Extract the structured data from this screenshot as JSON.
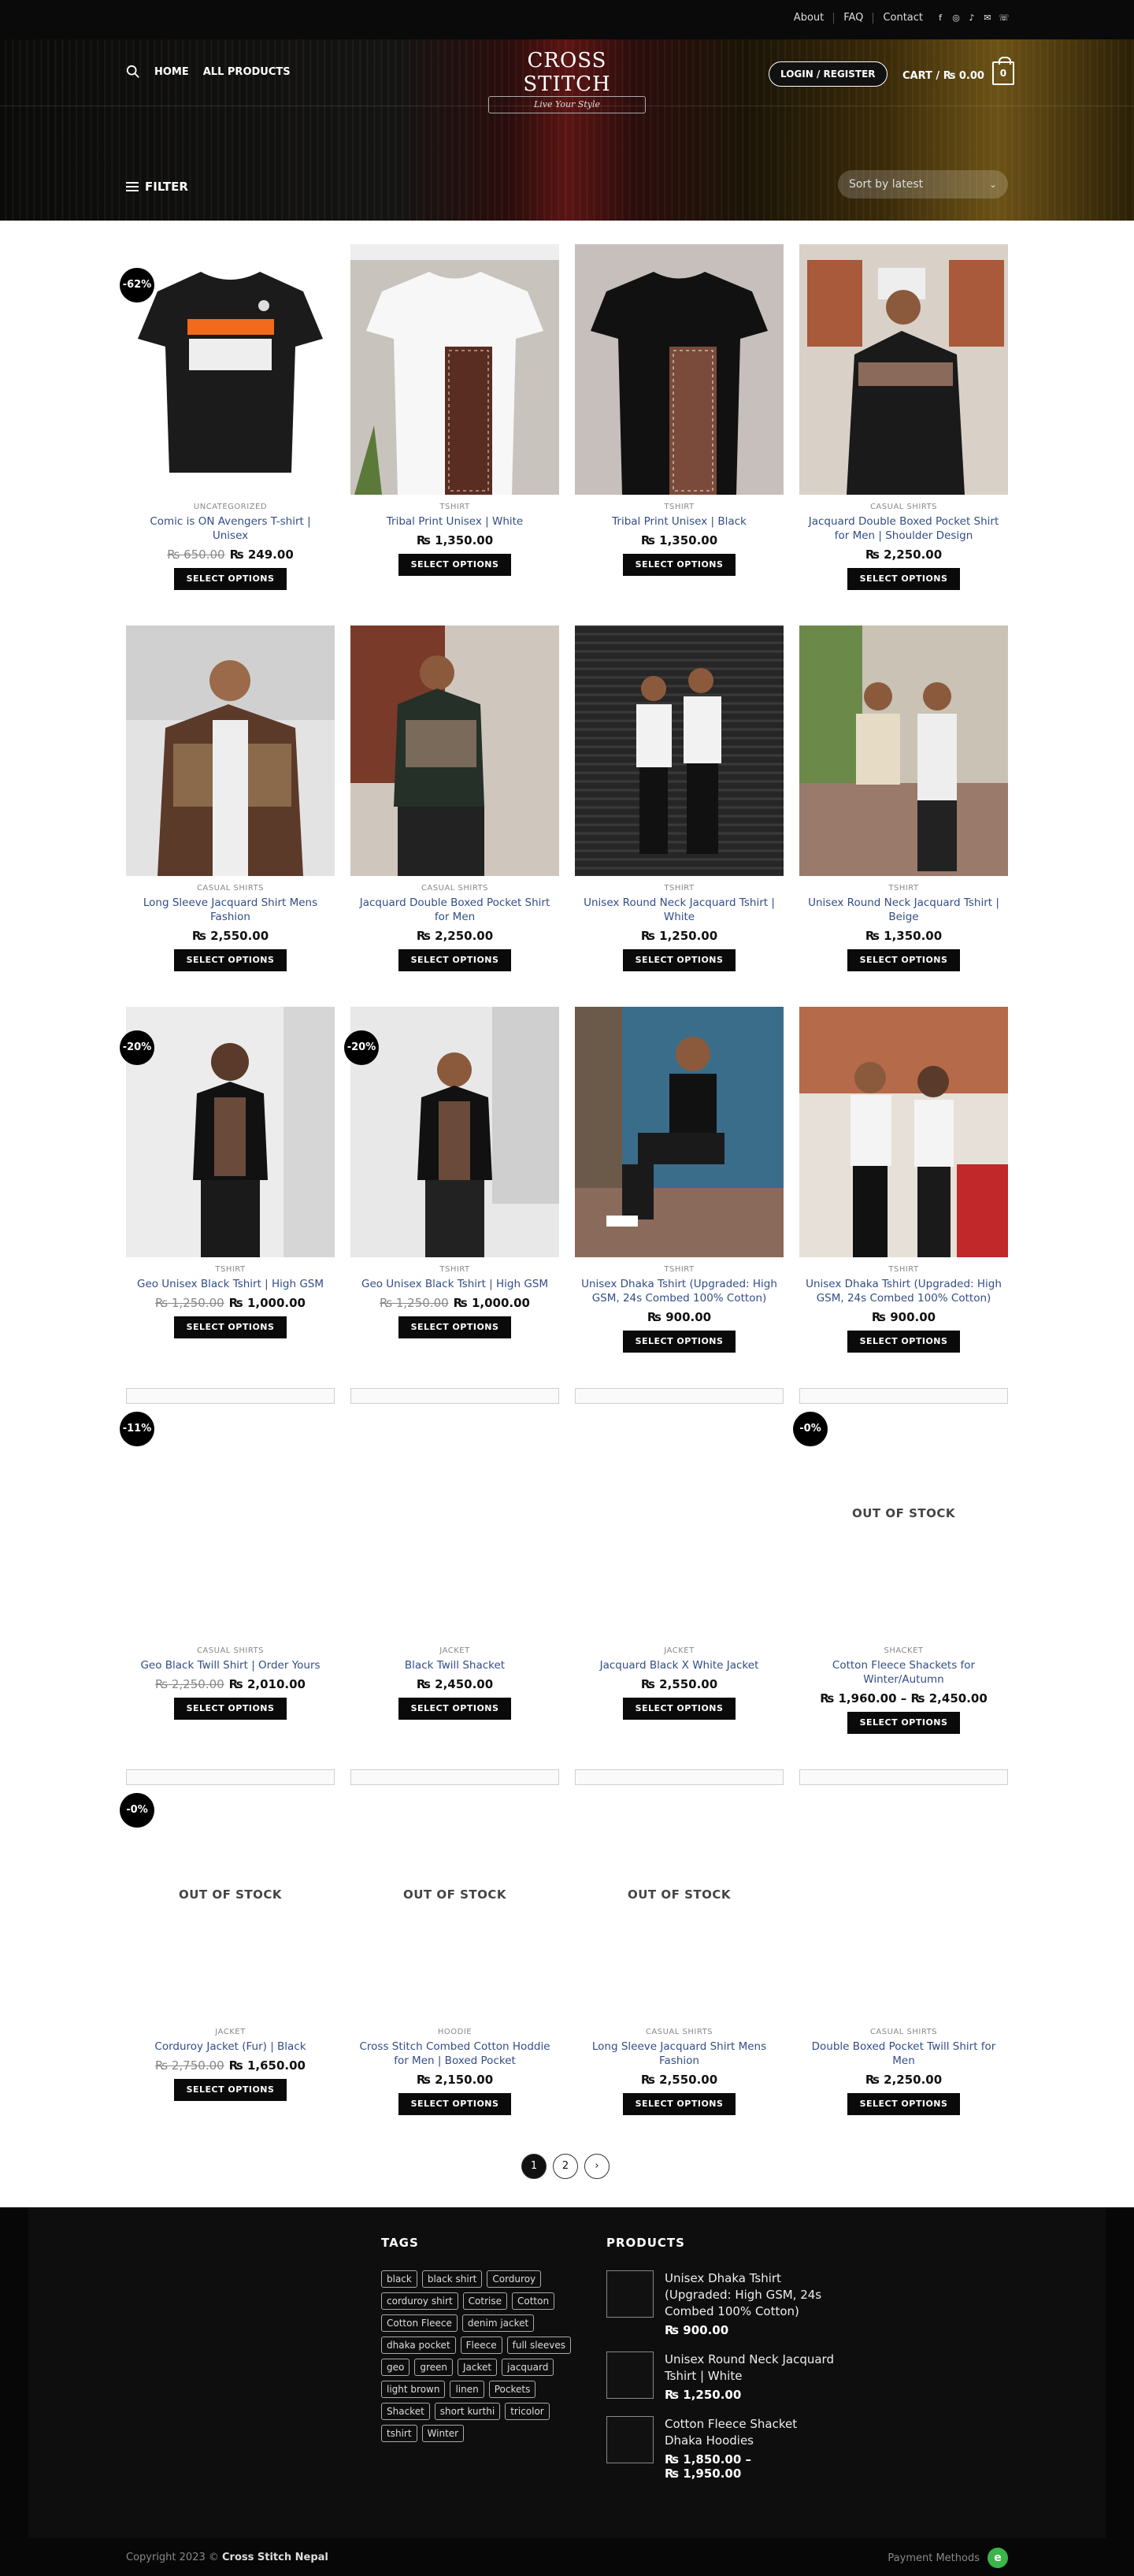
{
  "topbar": {
    "links": [
      "About",
      "FAQ",
      "Contact"
    ],
    "social_icons": [
      "facebook-icon",
      "instagram-icon",
      "tiktok-icon",
      "mail-icon",
      "phone-icon"
    ]
  },
  "header": {
    "nav": [
      "HOME",
      "ALL PRODUCTS"
    ],
    "logo_name": "CROSS STITCH",
    "logo_tagline": "Live Your Style",
    "login_label": "LOGIN / REGISTER",
    "cart_label": "CART / ₨ 0.00",
    "cart_count": "0",
    "filter_label": "FILTER",
    "sort_label": "Sort by latest"
  },
  "select_label": "SELECT OPTIONS",
  "products": [
    {
      "category": "UNCATEGORIZED",
      "title": "Comic is ON Avengers T-shirt | Unisex",
      "old_price": "₨ 650.00",
      "price": "₨ 249.00",
      "badge": "-62%",
      "image": "comic-tee",
      "oos": ""
    },
    {
      "category": "TSHIRT",
      "title": "Tribal Print Unisex | White",
      "old_price": "",
      "price": "₨ 1,350.00",
      "badge": "",
      "image": "white-tribal",
      "oos": ""
    },
    {
      "category": "TSHIRT",
      "title": "Tribal Print Unisex | Black",
      "old_price": "",
      "price": "₨ 1,350.00",
      "badge": "",
      "image": "black-tribal",
      "oos": ""
    },
    {
      "category": "CASUAL SHIRTS",
      "title": "Jacquard Double Boxed Pocket Shirt for Men | Shoulder Design",
      "old_price": "",
      "price": "₨ 2,250.00",
      "badge": "",
      "image": "street-shirt",
      "oos": ""
    },
    {
      "category": "CASUAL SHIRTS",
      "title": "Long Sleeve Jacquard Shirt Mens Fashion",
      "old_price": "",
      "price": "₨ 2,550.00",
      "badge": "",
      "image": "jacquard-longsleeve",
      "oos": ""
    },
    {
      "category": "CASUAL SHIRTS",
      "title": "Jacquard Double Boxed Pocket Shirt for Men",
      "old_price": "",
      "price": "₨ 2,250.00",
      "badge": "",
      "image": "temple-shirt",
      "oos": ""
    },
    {
      "category": "TSHIRT",
      "title": "Unisex Round Neck Jacquard Tshirt | White",
      "old_price": "",
      "price": "₨ 1,250.00",
      "badge": "",
      "image": "shutter-couple",
      "oos": ""
    },
    {
      "category": "TSHIRT",
      "title": "Unisex Round Neck Jacquard Tshirt | Beige",
      "old_price": "",
      "price": "₨ 1,350.00",
      "badge": "",
      "image": "beige-couple",
      "oos": ""
    },
    {
      "category": "TSHIRT",
      "title": "Geo Unisex Black Tshirt | High GSM",
      "old_price": "₨ 1,250.00",
      "price": "₨ 1,000.00",
      "badge": "-20%",
      "image": "geo-woman",
      "oos": ""
    },
    {
      "category": "TSHIRT",
      "title": "Geo Unisex Black Tshirt | High GSM",
      "old_price": "₨ 1,250.00",
      "price": "₨ 1,000.00",
      "badge": "-20%",
      "image": "geo-man",
      "oos": ""
    },
    {
      "category": "TSHIRT",
      "title": "Unisex Dhaka Tshirt (Upgraded: High GSM, 24s Combed 100% Cotton)",
      "old_price": "",
      "price": "₨ 900.00",
      "badge": "",
      "image": "dhaka-sitting",
      "oos": ""
    },
    {
      "category": "TSHIRT",
      "title": "Unisex Dhaka Tshirt (Upgraded: High GSM, 24s Combed 100% Cotton)",
      "old_price": "",
      "price": "₨ 900.00",
      "badge": "",
      "image": "dhaka-couple",
      "oos": ""
    },
    {
      "category": "CASUAL SHIRTS",
      "title": "Geo Black Twill Shirt | Order Yours",
      "old_price": "₨ 2,250.00",
      "price": "₨ 2,010.00",
      "badge": "-11%",
      "image": "broken",
      "oos": ""
    },
    {
      "category": "JACKET",
      "title": "Black Twill Shacket",
      "old_price": "",
      "price": "₨ 2,450.00",
      "badge": "",
      "image": "broken",
      "oos": ""
    },
    {
      "category": "JACKET",
      "title": "Jacquard Black X White Jacket",
      "old_price": "",
      "price": "₨ 2,550.00",
      "badge": "",
      "image": "broken",
      "oos": ""
    },
    {
      "category": "SHACKET",
      "title": "Cotton Fleece Shackets for Winter/Autumn",
      "old_price": "",
      "price": "₨ 1,960.00 – ₨ 2,450.00",
      "badge": "-0%",
      "image": "broken",
      "oos": "OUT OF STOCK"
    },
    {
      "category": "JACKET",
      "title": "Corduroy Jacket (Fur) | Black",
      "old_price": "₨ 2,750.00",
      "price": "₨ 1,650.00",
      "badge": "-0%",
      "image": "broken",
      "oos": "OUT OF STOCK"
    },
    {
      "category": "HOODIE",
      "title": "Cross Stitch Combed Cotton Hoddie for Men | Boxed Pocket",
      "old_price": "",
      "price": "₨ 2,150.00",
      "badge": "",
      "image": "broken",
      "oos": "OUT OF STOCK"
    },
    {
      "category": "CASUAL SHIRTS",
      "title": "Long Sleeve Jacquard Shirt Mens Fashion",
      "old_price": "",
      "price": "₨ 2,550.00",
      "badge": "",
      "image": "broken",
      "oos": "OUT OF STOCK"
    },
    {
      "category": "CASUAL SHIRTS",
      "title": "Double Boxed Pocket Twill Shirt for Men",
      "old_price": "",
      "price": "₨ 2,250.00",
      "badge": "",
      "image": "broken",
      "oos": ""
    }
  ],
  "pagination": [
    "1",
    "2",
    "›"
  ],
  "footer": {
    "tags_title": "TAGS",
    "tags": [
      "black",
      "black shirt",
      "Corduroy",
      "corduroy shirt",
      "Cotrise",
      "Cotton",
      "Cotton Fleece",
      "denim jacket",
      "dhaka pocket",
      "Fleece",
      "full sleeves",
      "geo",
      "green",
      "Jacket",
      "jacquard",
      "light brown",
      "linen",
      "Pockets",
      "Shacket",
      "short kurthi",
      "tricolor",
      "tshirt",
      "Winter"
    ],
    "products_title": "PRODUCTS",
    "products": [
      {
        "title": "Unisex Dhaka Tshirt (Upgraded: High GSM, 24s Combed 100% Cotton)",
        "price": "₨ 900.00"
      },
      {
        "title": "Unisex Round Neck Jacquard Tshirt | White",
        "price": "₨ 1,250.00"
      },
      {
        "title": "Cotton Fleece Shacket Dhaka Hoodies",
        "price": "₨ 1,850.00 –\n₨ 1,950.00"
      }
    ],
    "copyright_prefix": "Copyright 2023 © ",
    "copyright_brand": "Cross Stitch Nepal",
    "payment_label": "Payment Methods",
    "payment_icon": "e"
  }
}
